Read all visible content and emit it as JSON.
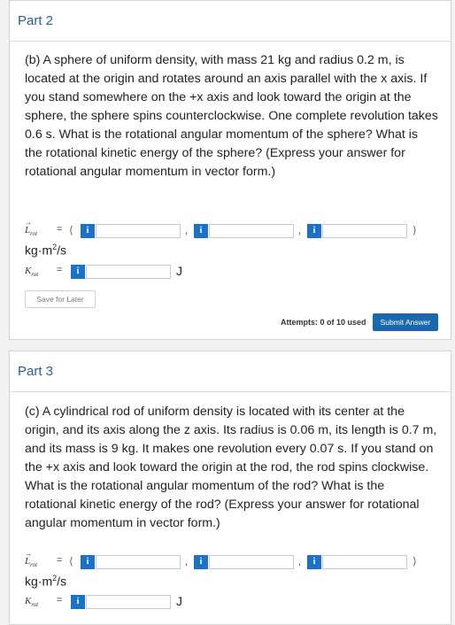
{
  "part2": {
    "title": "Part 2",
    "question": "(b) A sphere of uniform density, with mass 21 kg and radius 0.2 m, is located at the origin and rotates around an axis parallel with the x axis. If you stand somewhere on the +x axis and look toward the origin at the sphere, the sphere spins counterclockwise. One complete revolution takes 0.6 s. What is the rotational angular momentum of the sphere? What is the rotational kinetic energy of the sphere? (Express your answer for rotational angular momentum in vector form.)",
    "lrot_symbol": "L",
    "lrot_sub": "rot",
    "krot_symbol": "K",
    "krot_sub": "rot",
    "eq": "=",
    "open_paren": "⟨",
    "close_paren": "⟩",
    "comma": ",",
    "info_glyph": "i",
    "inputs": [
      "",
      "",
      "",
      ""
    ],
    "l_unit": "kg·m",
    "l_unit_exp": "2",
    "l_unit_tail": "/s",
    "k_unit": "J",
    "save_label": "Save for Later",
    "attempts_label": "Attempts: 0 of 10 used",
    "submit_label": "Submit Answer"
  },
  "part3": {
    "title": "Part 3",
    "question": "(c) A cylindrical rod of uniform density is located with its center at the origin, and its axis along the z axis. Its radius is 0.06 m, its length is 0.7 m, and its mass is 9 kg. It makes one revolution every 0.07 s. If you stand on the +x axis and look toward the origin at the rod, the rod spins clockwise. What is the rotational angular momentum of the rod? What is the rotational kinetic energy of the rod? (Express your answer for rotational angular momentum in vector form.)",
    "lrot_symbol": "L",
    "lrot_sub": "rot",
    "krot_symbol": "K",
    "krot_sub": "rot",
    "eq": "=",
    "open_paren": "⟨",
    "close_paren": "⟩",
    "comma": ",",
    "info_glyph": "i",
    "inputs": [
      "",
      "",
      "",
      ""
    ],
    "l_unit": "kg·m",
    "l_unit_exp": "2",
    "l_unit_tail": "/s",
    "k_unit": "J"
  },
  "colors": {
    "accent": "#1a73c7",
    "title": "#2b5f8f",
    "submit": "#1b68ad"
  }
}
